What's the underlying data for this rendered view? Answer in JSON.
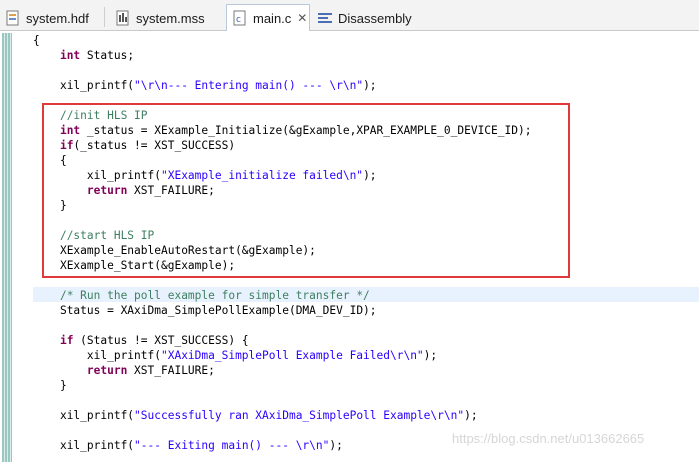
{
  "tabs": [
    {
      "label": "system.hdf",
      "icon": "hdf-file-icon"
    },
    {
      "label": "system.mss",
      "icon": "mss-file-icon"
    },
    {
      "label": "main.c",
      "icon": "c-file-icon",
      "active": true
    },
    {
      "label": "Disassembly",
      "icon": "disassembly-icon"
    }
  ],
  "tab_close_glyph": "✕",
  "code": {
    "l1": "{",
    "l2_kw": "int",
    "l2_rest": " Status;",
    "l4_a": "xil_printf(",
    "l4_str": "\"\\r\\n--- Entering main() --- \\r\\n\"",
    "l4_b": ");",
    "l6_cmt": "//init HLS IP",
    "l7_kw": "int",
    "l7_rest": " _status = XExample_Initialize(&gExample,XPAR_EXAMPLE_0_DEVICE_ID);",
    "l8_kw": "if",
    "l8_rest": "(_status != XST_SUCCESS)",
    "l9": "{",
    "l10_a": "xil_printf(",
    "l10_str": "\"XExample_initialize failed\\n\"",
    "l10_b": ");",
    "l11_kw": "return",
    "l11_rest": " XST_FAILURE;",
    "l12": "}",
    "l14_cmt": "//start HLS IP",
    "l15": "XExample_EnableAutoRestart(&gExample);",
    "l16": "XExample_Start(&gExample);",
    "l18_cmt": "/* Run the poll example for simple transfer */",
    "l19": "Status = XAxiDma_SimplePollExample(DMA_DEV_ID);",
    "l21_kw": "if",
    "l21_rest": " (Status != XST_SUCCESS) {",
    "l22_a": "xil_printf(",
    "l22_str": "\"XAxiDma_SimplePoll Example Failed\\r\\n\"",
    "l22_b": ");",
    "l23_kw": "return",
    "l23_rest": " XST_FAILURE;",
    "l24": "}",
    "l26_a": "xil_printf(",
    "l26_str": "\"Successfully ran XAxiDma_SimplePoll Example\\r\\n\"",
    "l26_b": ");",
    "l28_a": "xil_printf(",
    "l28_str": "\"--- Exiting main() --- \\r\\n\"",
    "l28_b": ");"
  },
  "watermark": "https://blog.csdn.net/u013662665",
  "colors": {
    "keyword": "#7f0055",
    "string": "#2a00ff",
    "comment": "#3f7f5f",
    "annotation_box": "#e0393b",
    "current_line": "#e8f2fe"
  }
}
